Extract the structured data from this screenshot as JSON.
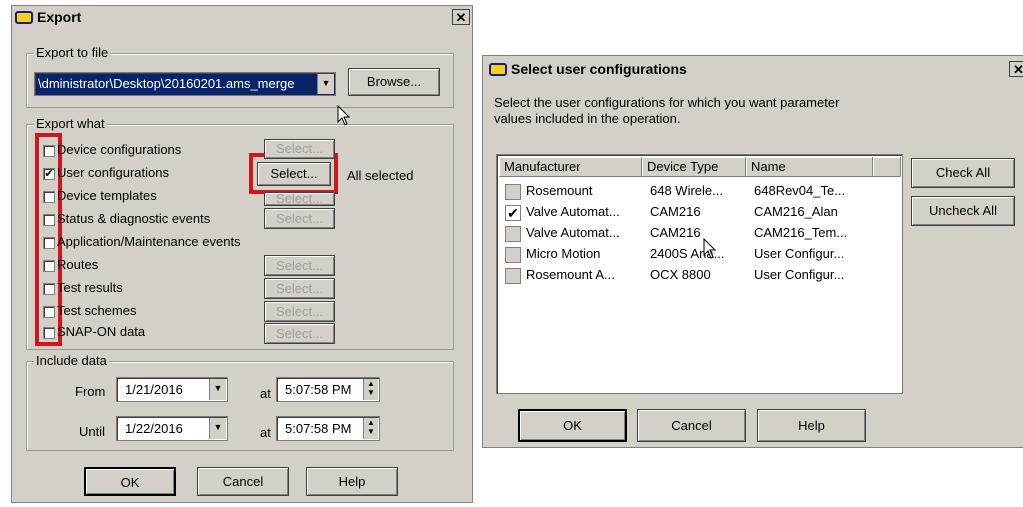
{
  "export_dialog": {
    "title": "Export",
    "close": "✕",
    "export_to_file": {
      "legend": "Export to file",
      "path_value": "\\dministrator\\Desktop\\20160201.ams_merge",
      "browse_label": "Browse..."
    },
    "export_what": {
      "legend": "Export what",
      "items": [
        {
          "label": "Device configurations",
          "checked": false,
          "select_label": "Select...",
          "select_enabled": false
        },
        {
          "label": "User configurations",
          "checked": true,
          "select_label": "Select...",
          "select_enabled": true,
          "status": "All selected"
        },
        {
          "label": "Device templates",
          "checked": false,
          "select_label": "Select...",
          "select_enabled": false
        },
        {
          "label": "Status & diagnostic events",
          "checked": false,
          "select_label": "Select...",
          "select_enabled": false
        },
        {
          "label": "Application/Maintenance events",
          "checked": false
        },
        {
          "label": "Routes",
          "checked": false,
          "select_label": "Select...",
          "select_enabled": false
        },
        {
          "label": "Test results",
          "checked": false,
          "select_label": "Select...",
          "select_enabled": false
        },
        {
          "label": "Test schemes",
          "checked": false,
          "select_label": "Select...",
          "select_enabled": false
        },
        {
          "label": "SNAP-ON data",
          "checked": false,
          "select_label": "Select...",
          "select_enabled": false
        }
      ]
    },
    "include_data": {
      "legend": "Include data",
      "from_label": "From",
      "from_date": "1/21/2016",
      "from_at": "at",
      "from_time": "5:07:58 PM",
      "until_label": "Until",
      "until_date": "1/22/2016",
      "until_at": "at",
      "until_time": "5:07:58 PM"
    },
    "buttons": {
      "ok": "OK",
      "cancel": "Cancel",
      "help": "Help"
    }
  },
  "select_dialog": {
    "title": "Select user configurations",
    "close": "✕",
    "description_line1": "Select the user configurations for which you want parameter",
    "description_line2": "values included in the operation.",
    "columns": [
      "Manufacturer",
      "Device Type",
      "Name"
    ],
    "rows": [
      {
        "manufacturer": "Rosemount",
        "device_type": "648 Wirele...",
        "name": "648Rev04_Te...",
        "checked": false
      },
      {
        "manufacturer": "Valve Automat...",
        "device_type": "CAM216",
        "name": "CAM216_Alan",
        "checked": true
      },
      {
        "manufacturer": "Valve Automat...",
        "device_type": "CAM216",
        "name": "CAM216_Tem...",
        "checked": false
      },
      {
        "manufacturer": "Micro Motion",
        "device_type": "2400S Ana...",
        "name": "User Configur...",
        "checked": false
      },
      {
        "manufacturer": "Rosemount A...",
        "device_type": "OCX 8800",
        "name": "User Configur...",
        "checked": false
      }
    ],
    "check_all": "Check All",
    "uncheck_all": "Uncheck All",
    "buttons": {
      "ok": "OK",
      "cancel": "Cancel",
      "help": "Help"
    }
  },
  "colors": {
    "highlight_red": "#d0161c",
    "dialog_face": "#d4d0c8",
    "selection_blue": "#0a246a"
  }
}
